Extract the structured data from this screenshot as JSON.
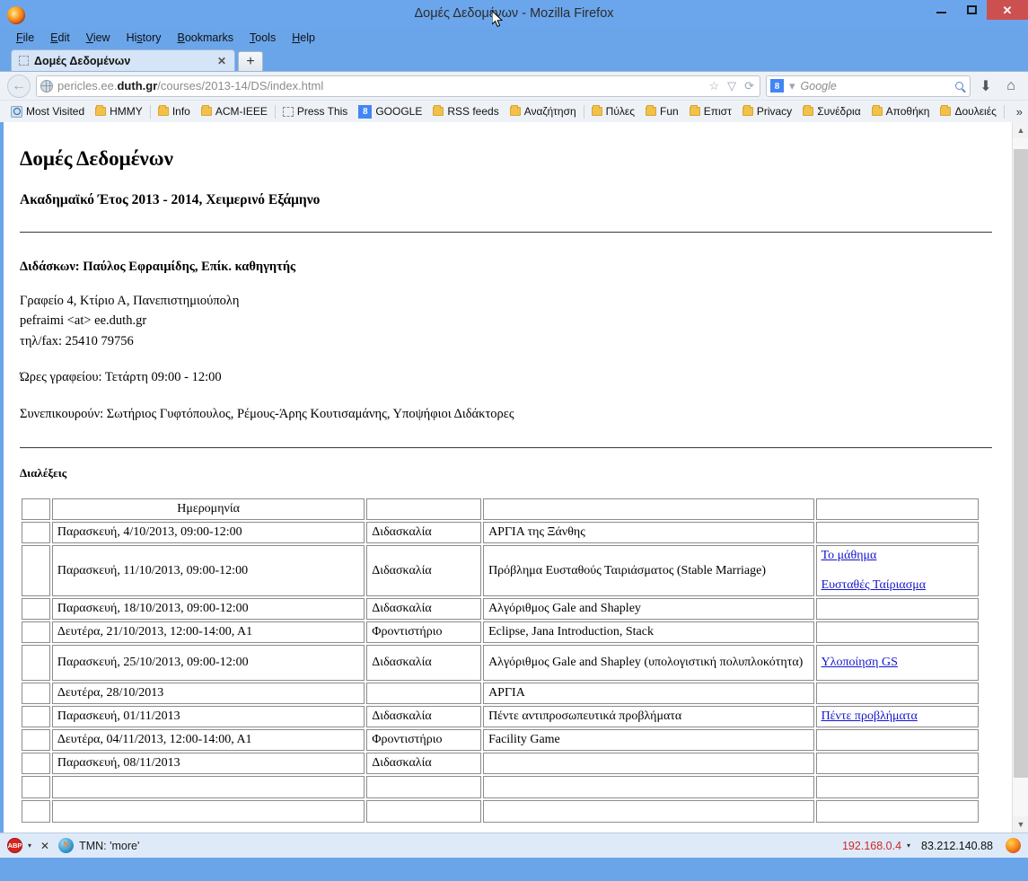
{
  "window": {
    "title": "Δομές Δεδομένων - Mozilla Firefox",
    "minimize_label": "–",
    "maximize_label": "□",
    "close_label": "✕"
  },
  "menubar": {
    "items": [
      {
        "label": "File"
      },
      {
        "label": "Edit"
      },
      {
        "label": "View"
      },
      {
        "label": "History"
      },
      {
        "label": "Bookmarks"
      },
      {
        "label": "Tools"
      },
      {
        "label": "Help"
      }
    ]
  },
  "tabs": {
    "active": {
      "label": "Δομές Δεδομένων",
      "close": "✕"
    },
    "new_tab": "+"
  },
  "navbar": {
    "back": "←",
    "url_prefix": "pericles.ee.",
    "url_domain": "duth.gr",
    "url_path": "/courses/2013-14/DS/index.html",
    "url_full": "pericles.ee.duth.gr/courses/2013-14/DS/index.html",
    "bookmark_star": "☆",
    "dropdown_caret": "▽",
    "reload": "⟳",
    "search_engine": "8",
    "search_engine_caret": "▾",
    "search_placeholder": "Google",
    "download_icon": "⬇",
    "home_icon": "⌂"
  },
  "bookmarks": {
    "items": [
      {
        "label": "Most Visited",
        "icon": "star-folder-icon"
      },
      {
        "label": "HMMY",
        "icon": "folder-icon"
      },
      {
        "label": "Info",
        "icon": "folder-icon"
      },
      {
        "label": "ACM-IEEE",
        "icon": "folder-icon"
      },
      {
        "label": "Press This",
        "icon": "dashed-icon"
      },
      {
        "label": "GOOGLE",
        "icon": "google-icon"
      },
      {
        "label": "RSS feeds",
        "icon": "folder-icon"
      },
      {
        "label": "Αναζήτηση",
        "icon": "folder-icon"
      },
      {
        "label": "Πύλες",
        "icon": "folder-icon"
      },
      {
        "label": "Fun",
        "icon": "folder-icon"
      },
      {
        "label": "Επιστ",
        "icon": "folder-icon"
      },
      {
        "label": "Privacy",
        "icon": "folder-icon"
      },
      {
        "label": "Συνέδρια",
        "icon": "folder-icon"
      },
      {
        "label": "Αποθήκη",
        "icon": "folder-icon"
      },
      {
        "label": "Δουλειές",
        "icon": "folder-icon"
      }
    ],
    "overflow": "»"
  },
  "page": {
    "title": "Δομές Δεδομένων",
    "subtitle": "Ακαδημαϊκό Έτος 2013 - 2014, Χειμερινό Εξάμηνο",
    "instructor_line": "Διδάσκων: Παύλος Εφραιμίδης, Επίκ. καθηγητής",
    "office": "Γραφείο 4, Κτίριο Α, Πανεπιστημιούπολη",
    "email": "pefraimi <at> ee.duth.gr",
    "phone": "τηλ/fax: 25410 79756",
    "office_hours": "Ώρες γραφείου: Τετάρτη 09:00 - 12:00",
    "assistants": "Συνεπικουρούν: Σωτήριος Γυφτόπουλος, Ρέμους-Άρης Κουτισαμάνης, Υποψήφιοι Διδάκτορες",
    "lectures_heading": "Διαλέξεις",
    "table": {
      "headers": [
        "",
        "Ημερομηνία",
        "",
        "",
        ""
      ],
      "rows": [
        {
          "num": "",
          "date": "Παρασκευή, 4/10/2013, 09:00-12:00",
          "type": "Διδασκαλία",
          "topic": "ΑΡΓΙΑ της Ξάνθης",
          "links": []
        },
        {
          "num": "",
          "date": "Παρασκευή, 11/10/2013, 09:00-12:00",
          "type": "Διδασκαλία",
          "topic": "Πρόβλημα Ευσταθούς Ταιριάσματος (Stable Marriage)",
          "links": [
            "Το μάθημα",
            "Ευσταθές Ταίριασμα"
          ]
        },
        {
          "num": "",
          "date": "Παρασκευή, 18/10/2013, 09:00-12:00",
          "type": "Διδασκαλία",
          "topic": "Αλγόριθμος Gale and Shapley",
          "links": []
        },
        {
          "num": "",
          "date": "Δευτέρα, 21/10/2013, 12:00-14:00, Α1",
          "type": "Φροντιστήριο",
          "topic": "Eclipse, Jana Introduction, Stack",
          "links": []
        },
        {
          "num": "",
          "date": "Παρασκευή, 25/10/2013, 09:00-12:00",
          "type": "Διδασκαλία",
          "topic": "Αλγόριθμος Gale and Shapley (υπολογιστική πολυπλοκότητα)",
          "links": [
            "Υλοποίηση GS"
          ]
        },
        {
          "num": "",
          "date": "Δευτέρα, 28/10/2013",
          "type": "",
          "topic": "ΑΡΓΙΑ",
          "links": []
        },
        {
          "num": "",
          "date": "Παρασκευή, 01/11/2013",
          "type": "Διδασκαλία",
          "topic": "Πέντε αντιπροσωπευτικά προβλήματα",
          "links": [
            "Πέντε προβλήματα"
          ]
        },
        {
          "num": "",
          "date": "Δευτέρα, 04/11/2013, 12:00-14:00, Α1",
          "type": "Φροντιστήριο",
          "topic": "Facility Game",
          "links": []
        },
        {
          "num": "",
          "date": "Παρασκευή, 08/11/2013",
          "type": "Διδασκαλία",
          "topic": "",
          "links": []
        },
        {
          "num": "",
          "date": "",
          "type": "",
          "topic": "",
          "links": []
        },
        {
          "num": "",
          "date": "",
          "type": "",
          "topic": "",
          "links": []
        }
      ]
    }
  },
  "statusbar": {
    "abp_label": "ABP",
    "abp_caret": "▾",
    "close_label": "✕",
    "tmn_icon": "N",
    "tmn_text": "TMN: 'more'",
    "ip_local": "192.168.0.4",
    "ip_local_caret": "▾",
    "ip_public": "83.212.140.88"
  },
  "colors": {
    "window_frame": "#6aa5ea",
    "close_button": "#cd5050",
    "link": "#1414cc",
    "status_ip_local": "#cc2a2a",
    "google_blue": "#4285f4"
  }
}
